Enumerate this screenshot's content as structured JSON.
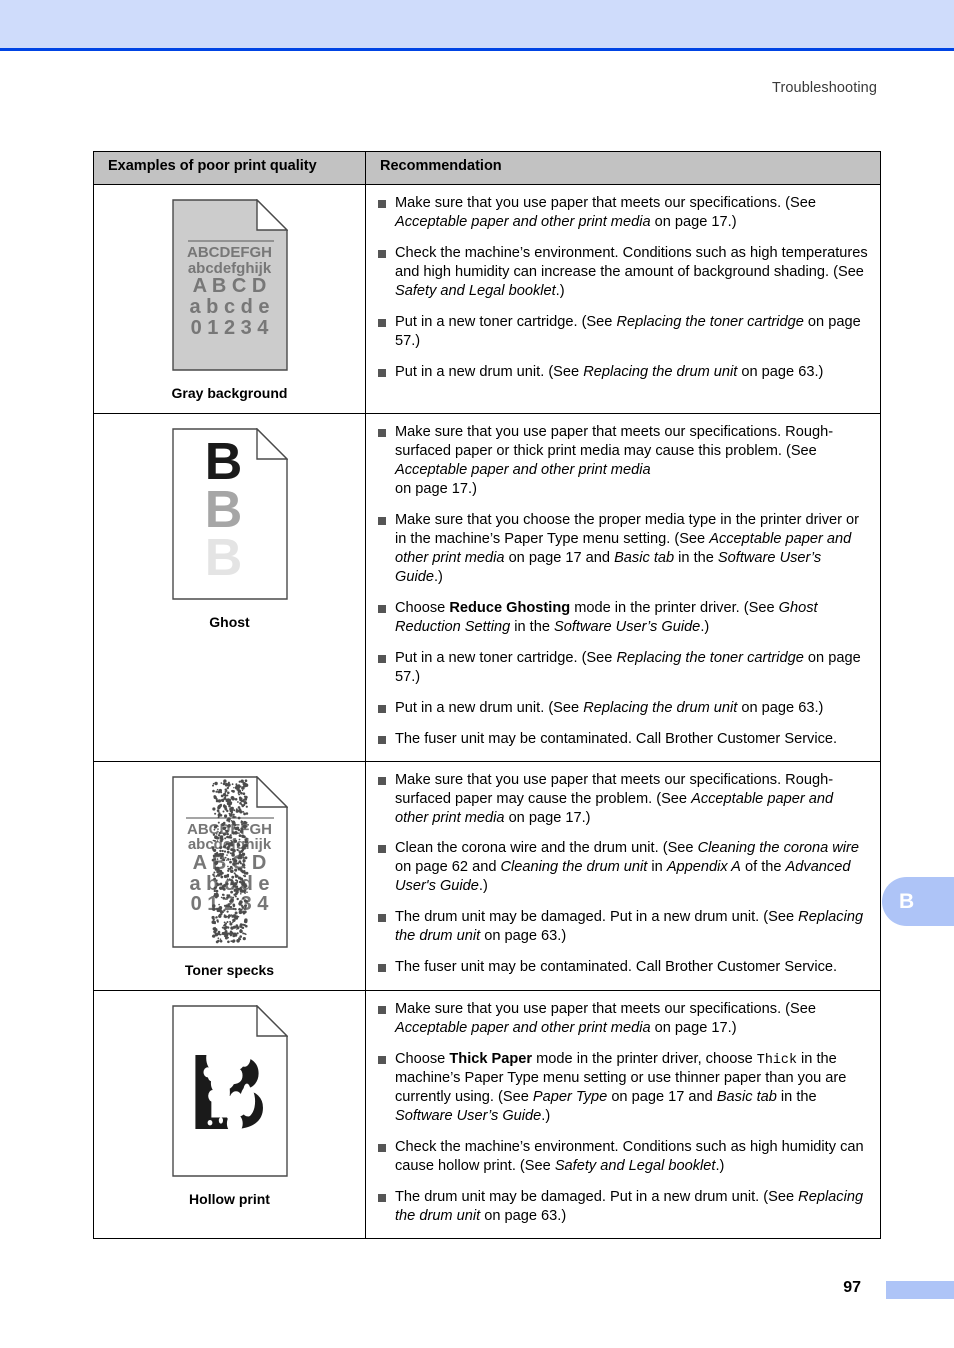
{
  "header": {
    "running_title": "Troubleshooting"
  },
  "footer": {
    "page_number": "97"
  },
  "side_tab": {
    "label": "B"
  },
  "table": {
    "columns": [
      "Examples of poor print quality",
      "Recommendation"
    ],
    "rows": [
      {
        "caption": "Gray background",
        "sample": {
          "type": "gray-background-page",
          "lines": [
            "ABCDEFGH",
            "abcdefghijk",
            "A B C D",
            "a b c d e",
            "0 1 2 3 4"
          ]
        },
        "recommendations": [
          "Make sure that you use paper that meets our specifications. (See <i>Acceptable paper and other print media</i> on page 17.)",
          "Check the machine’s environment. Conditions such as high temperatures and high humidity can increase the amount of background shading. (See <i>Safety and Legal booklet</i>.)",
          "Put in a new toner cartridge. (See <i>Replacing the toner cartridge</i> on page 57.)",
          "Put in a new drum unit. (See <i>Replacing the drum unit</i> on page 63.)"
        ]
      },
      {
        "caption": "Ghost",
        "sample": {
          "type": "ghost-page",
          "letters": [
            "B",
            "B",
            "B"
          ]
        },
        "recommendations": [
          "Make sure that you use paper that meets our specifications. Rough-surfaced paper or thick print media may cause this problem. (See <i>Acceptable paper and other print media</i><br>on page 17.)",
          "Make sure that you choose the proper media type in the printer driver or in the machine’s Paper Type menu setting. (See <i>Acceptable paper and other print media</i> on page 17 and <i>Basic tab</i> in the <i>Software User’s Guide</i>.)",
          "Choose <b>Reduce Ghosting</b> mode in the printer driver. (See <i>Ghost Reduction Setting</i> in the <i>Software User’s Guide</i>.)",
          "Put in a new toner cartridge. (See <i>Replacing the toner cartridge</i> on page 57.)",
          "Put in a new drum unit. (See <i>Replacing the drum unit</i> on page 63.)",
          "The fuser unit may be contaminated. Call Brother Customer Service."
        ]
      },
      {
        "caption": "Toner specks",
        "sample": {
          "type": "toner-specks-page",
          "lines": [
            "ABCDEFGH",
            "abcdefghijk",
            "A B C D",
            "a b c d e",
            "0 1 2 3 4"
          ]
        },
        "recommendations": [
          "Make sure that you use paper that meets our specifications. Rough-surfaced paper may cause the problem. (See <i>Acceptable paper and other print media</i> on page 17.)",
          "Clean the corona wire and the drum unit. (See <i>Cleaning the corona wire</i> on page 62 and <i>Cleaning the drum unit</i> in <i>Appendix A</i> of the <i>Advanced User's Guide</i>.)",
          "The drum unit may be damaged. Put in a new drum unit. (See <i>Replacing the drum unit</i> on page 63.)",
          "The fuser unit may be contaminated. Call Brother Customer Service."
        ]
      },
      {
        "caption": "Hollow print",
        "sample": {
          "type": "hollow-print-page",
          "letters": [
            "B"
          ]
        },
        "recommendations": [
          "Make sure that you use paper that meets our specifications. (See <i>Acceptable paper and other print media</i> on page 17.)",
          "Choose <b>Thick Paper</b> mode in the printer driver, choose <code>Thick</code> in the machine’s Paper Type menu setting or use thinner paper than you are currently using. (See <i>Paper Type</i> on page 17 and <i>Basic tab</i> in the <i>Software User’s Guide</i>.)",
          "Check the machine’s environment. Conditions such as high humidity can cause hollow print. (See <i>Safety and Legal booklet</i>.)",
          "The drum unit may be damaged. Put in a new drum unit. (See <i>Replacing the drum unit</i> on page 63.)"
        ]
      }
    ]
  },
  "colors": {
    "band": "#cfdcfb",
    "rule": "#0044e4",
    "tab": "#aec4f7",
    "header_fill": "#c2c2c2",
    "sample_gray": "#cccccc",
    "sample_text": "#777777"
  }
}
